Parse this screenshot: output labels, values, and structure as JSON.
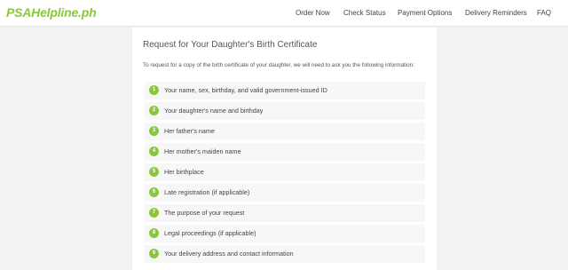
{
  "header": {
    "logo": "PSAHelpline.ph",
    "nav": [
      {
        "label": "Order Now"
      },
      {
        "label": "Check Status"
      },
      {
        "label": "Payment Options"
      },
      {
        "label": "Delivery Reminders"
      },
      {
        "label": "FAQ"
      }
    ]
  },
  "main": {
    "title": "Request for Your Daughter's Birth Certificate",
    "intro": "To request for a copy of the birth certificate of your daughter, we will need to ask you the following information:",
    "steps": [
      {
        "num": "1",
        "text": "Your name, sex, birthday, and valid government-issued ID"
      },
      {
        "num": "2",
        "text": "Your daughter's name and birthday"
      },
      {
        "num": "3",
        "text": "Her father's name"
      },
      {
        "num": "4",
        "text": "Her mother's maiden name"
      },
      {
        "num": "5",
        "text": "Her birthplace"
      },
      {
        "num": "6",
        "text": "Late registration (if applicable)"
      },
      {
        "num": "7",
        "text": "The purpose of your request"
      },
      {
        "num": "8",
        "text": "Legal proceedings (if applicable)"
      },
      {
        "num": "9",
        "text": "Your delivery address and contact information"
      }
    ]
  },
  "colors": {
    "accent": "#8cc63f",
    "background": "#f2f2f2"
  }
}
